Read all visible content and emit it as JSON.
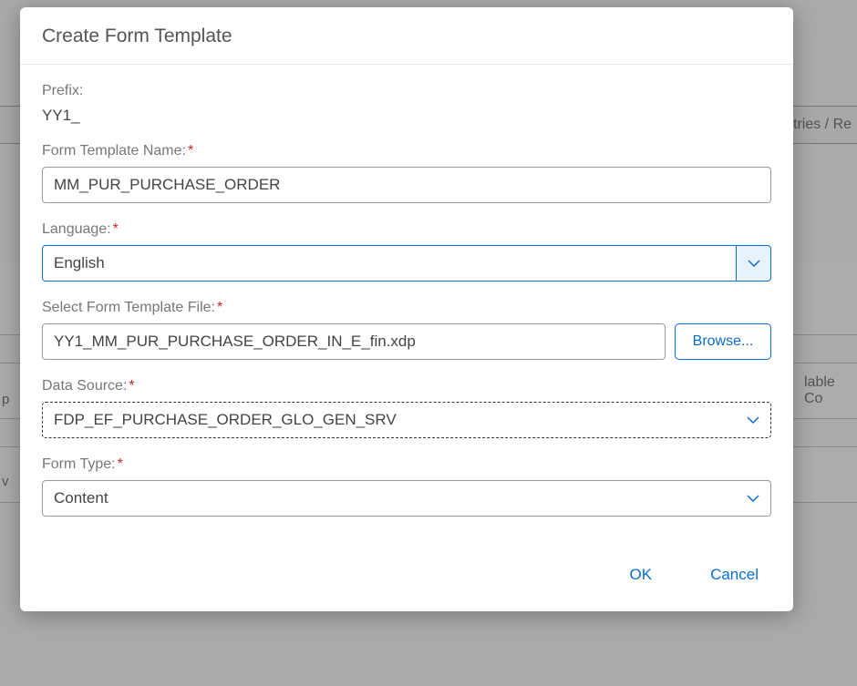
{
  "dialog": {
    "title": "Create Form Template",
    "fields": {
      "prefix": {
        "label": "Prefix:",
        "value": "YY1_"
      },
      "template_name": {
        "label": "Form Template Name:",
        "value": "MM_PUR_PURCHASE_ORDER"
      },
      "language": {
        "label": "Language:",
        "value": "English"
      },
      "template_file": {
        "label": "Select Form Template File:",
        "value": "YY1_MM_PUR_PURCHASE_ORDER_IN_E_fin.xdp",
        "browse_label": "Browse..."
      },
      "data_source": {
        "label": "Data Source:",
        "value": "FDP_EF_PURCHASE_ORDER_GLO_GEN_SRV"
      },
      "form_type": {
        "label": "Form Type:",
        "value": "Content"
      }
    },
    "buttons": {
      "ok": "OK",
      "cancel": "Cancel"
    }
  },
  "background": {
    "partial_text_1": "tries / Re",
    "partial_text_2": "lable Co",
    "partial_left_1": "p",
    "partial_left_2": "v"
  },
  "asterisk": "*"
}
